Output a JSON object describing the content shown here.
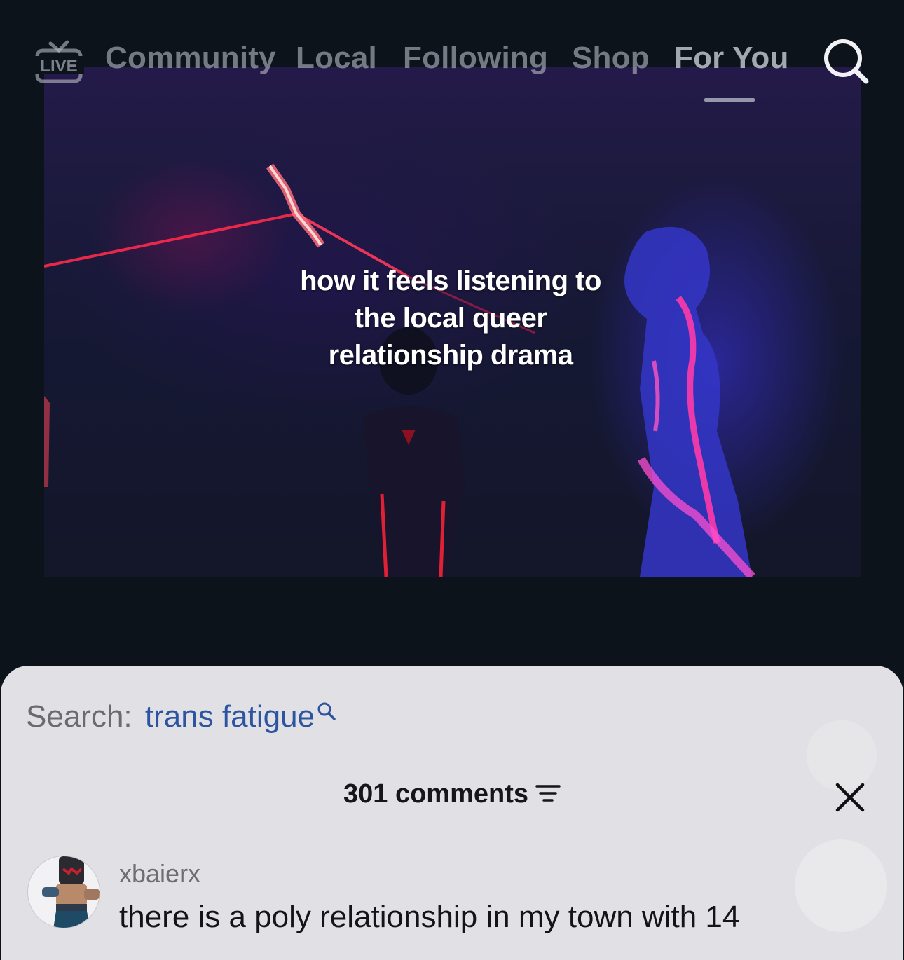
{
  "nav": {
    "live_badge": "LIVE",
    "tabs": [
      {
        "label": "Community"
      },
      {
        "label": "Local"
      },
      {
        "label": "Following"
      },
      {
        "label": "Shop"
      },
      {
        "label": "For You",
        "active": true
      }
    ],
    "search_icon": "search-icon"
  },
  "video": {
    "caption_lines": [
      "how it feels listening to",
      "the local queer",
      "relationship drama"
    ]
  },
  "comments_sheet": {
    "search_label": "Search:",
    "search_query": "trans fatigue",
    "header": "301 comments",
    "filter_icon": "filter-icon",
    "close_icon": "close-icon",
    "comments": [
      {
        "username": "xbaierx",
        "text": "there is a poly relationship in my town with 14"
      }
    ]
  },
  "colors": {
    "background": "#0c131b",
    "sheet": "#e1e1e5",
    "search_query": "#2d54a0",
    "laser": "#ff2a4a"
  }
}
